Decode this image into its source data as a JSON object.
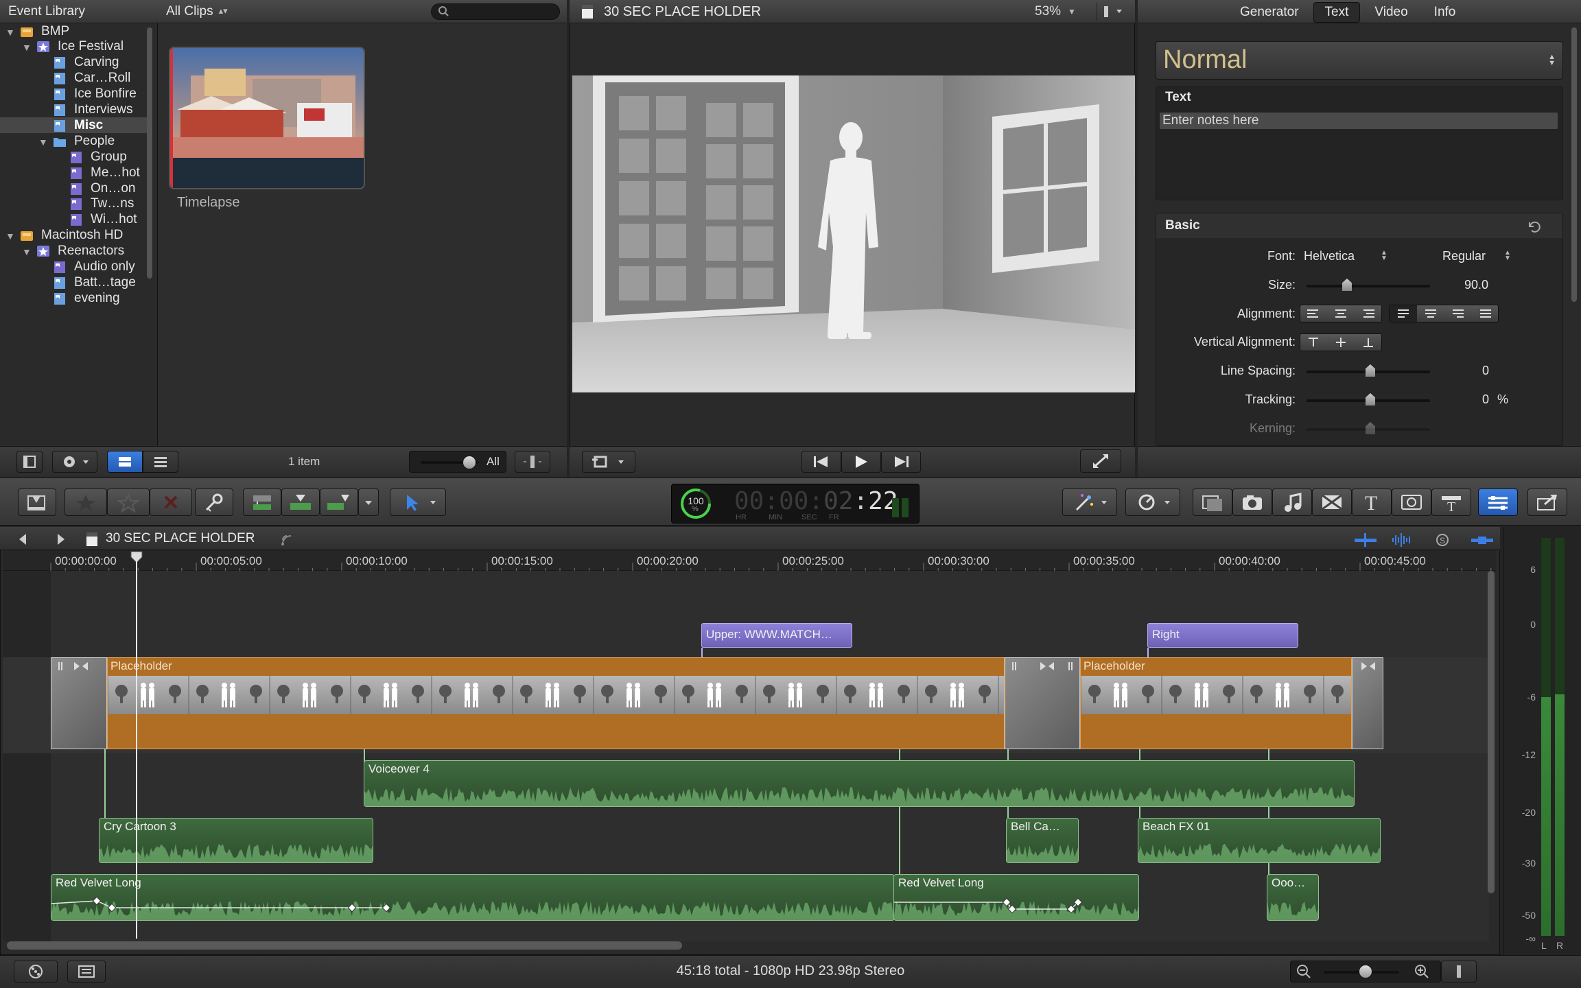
{
  "event_library": {
    "title": "Event Library",
    "filter": "All Clips",
    "tree": [
      {
        "label": "BMP",
        "level": 0,
        "kind": "disk",
        "expanded": true
      },
      {
        "label": "Ice Festival",
        "level": 1,
        "kind": "event",
        "expanded": true
      },
      {
        "label": "Carving",
        "level": 2,
        "kind": "keyword"
      },
      {
        "label": "Car…Roll",
        "level": 2,
        "kind": "keyword"
      },
      {
        "label": "Ice Bonfire",
        "level": 2,
        "kind": "keyword"
      },
      {
        "label": "Interviews",
        "level": 2,
        "kind": "keyword"
      },
      {
        "label": "Misc",
        "level": 2,
        "kind": "keyword",
        "selected": true
      },
      {
        "label": "People",
        "level": 2,
        "kind": "folder",
        "expanded": true
      },
      {
        "label": "Group",
        "level": 3,
        "kind": "smart"
      },
      {
        "label": "Me…hot",
        "level": 3,
        "kind": "smart"
      },
      {
        "label": "On…on",
        "level": 3,
        "kind": "smart"
      },
      {
        "label": "Tw…ns",
        "level": 3,
        "kind": "smart"
      },
      {
        "label": "Wi…hot",
        "level": 3,
        "kind": "smart"
      },
      {
        "label": "Macintosh HD",
        "level": 0,
        "kind": "disk",
        "expanded": true
      },
      {
        "label": "Reenactors",
        "level": 1,
        "kind": "event",
        "expanded": true
      },
      {
        "label": "Audio only",
        "level": 2,
        "kind": "smart"
      },
      {
        "label": "Batt…tage",
        "level": 2,
        "kind": "keyword"
      },
      {
        "label": "evening",
        "level": 2,
        "kind": "keyword"
      }
    ],
    "clip_name": "Timelapse",
    "item_count": "1 item",
    "duration_filter": "All"
  },
  "viewer": {
    "title": "30 SEC PLACE HOLDER",
    "zoom": "53%"
  },
  "inspector": {
    "tabs": [
      "Generator",
      "Text",
      "Video",
      "Info"
    ],
    "active_tab": "Text",
    "preset": "Normal",
    "text_section_label": "Text",
    "text_value": "Enter notes here",
    "basic_label": "Basic",
    "font_label": "Font:",
    "font_value": "Helvetica",
    "font_style": "Regular",
    "size_label": "Size:",
    "size_value": "90.0",
    "alignment_label": "Alignment:",
    "valign_label": "Vertical Alignment:",
    "line_spacing_label": "Line Spacing:",
    "line_spacing_value": "0",
    "tracking_label": "Tracking:",
    "tracking_value": "0",
    "tracking_unit": "%",
    "kerning_label": "Kerning:"
  },
  "toolbar": {
    "timecode": {
      "hr": "00",
      "min": "00",
      "sec": "02",
      "fr": "22",
      "hr_label": "HR",
      "min_label": "MIN",
      "sec_label": "SEC",
      "fr_label": "FR"
    },
    "meter_pct": "100",
    "meter_unit": "%"
  },
  "timeline": {
    "project": "30 SEC PLACE HOLDER",
    "ruler": [
      "00:00:00:00",
      "00:00:05:00",
      "00:00:10:00",
      "00:00:15:00",
      "00:00:20:00",
      "00:00:25:00",
      "00:00:30:00",
      "00:00:35:00",
      "00:00:40:00",
      "00:00:45:00"
    ],
    "titles": [
      "Upper: WWW.MATCH…",
      "Right"
    ],
    "video_clips": [
      "Placeholder",
      "Placeholder"
    ],
    "audio_clips": {
      "voiceover": "Voiceover 4",
      "cry": "Cry Cartoon 3",
      "bell": "Bell Ca…",
      "beach": "Beach FX 01",
      "rv1": "Red Velvet Long",
      "rv2": "Red Velvet Long",
      "ooo": "Ooo…"
    }
  },
  "audio_meter": {
    "scale": [
      "6",
      "0",
      "-6",
      "-12",
      "-20",
      "-30",
      "-50",
      "-∞"
    ],
    "channels": [
      "L",
      "R"
    ]
  },
  "status_bar": {
    "text": "45:18 total - 1080p HD 23.98p Stereo"
  },
  "colors": {
    "storyline": "#c07a2a",
    "audio": "#3f6a3f",
    "title": "#7d6fc9",
    "accent": "#2f6fd8"
  }
}
